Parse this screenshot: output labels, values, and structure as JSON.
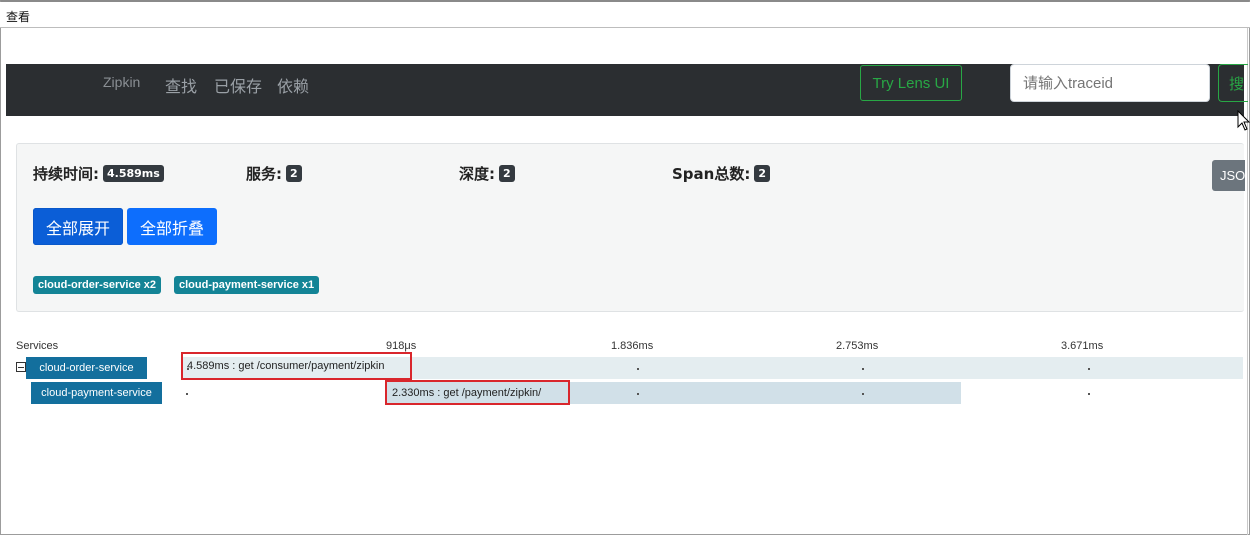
{
  "menubar": {
    "view_label": "查看"
  },
  "navbar": {
    "brand": "Zipkin",
    "links": [
      "查找",
      "已保存",
      "依赖"
    ],
    "lens_button": "Try Lens UI",
    "search_placeholder": "请输入traceid",
    "search_button": "搜"
  },
  "summary": {
    "duration_label": "持续时间:",
    "duration_value": "4.589ms",
    "services_label": "服务:",
    "services_value": "2",
    "depth_label": "深度:",
    "depth_value": "2",
    "span_total_label": "Span总数:",
    "span_total_value": "2",
    "json_button": "JSON",
    "expand_all": "全部展开",
    "collapse_all": "全部折叠",
    "service_badges": [
      "cloud-order-service x2",
      "cloud-payment-service x1"
    ]
  },
  "timeline": {
    "services_header": "Services",
    "ticks": [
      "918μs",
      "1.836ms",
      "2.753ms",
      "3.671ms"
    ],
    "rows": [
      {
        "service": "cloud-order-service",
        "span": "4.589ms : get /consumer/payment/zipkin"
      },
      {
        "service": "cloud-payment-service",
        "span": "2.330ms : get /payment/zipkin/"
      }
    ]
  },
  "colors": {
    "navbar_bg": "#2b2e31",
    "accent_green": "#28a745",
    "primary_blue": "#0d6efd",
    "badge_teal": "#138496",
    "service_label_blue": "#136f9d",
    "highlight_red": "#d9262c"
  }
}
